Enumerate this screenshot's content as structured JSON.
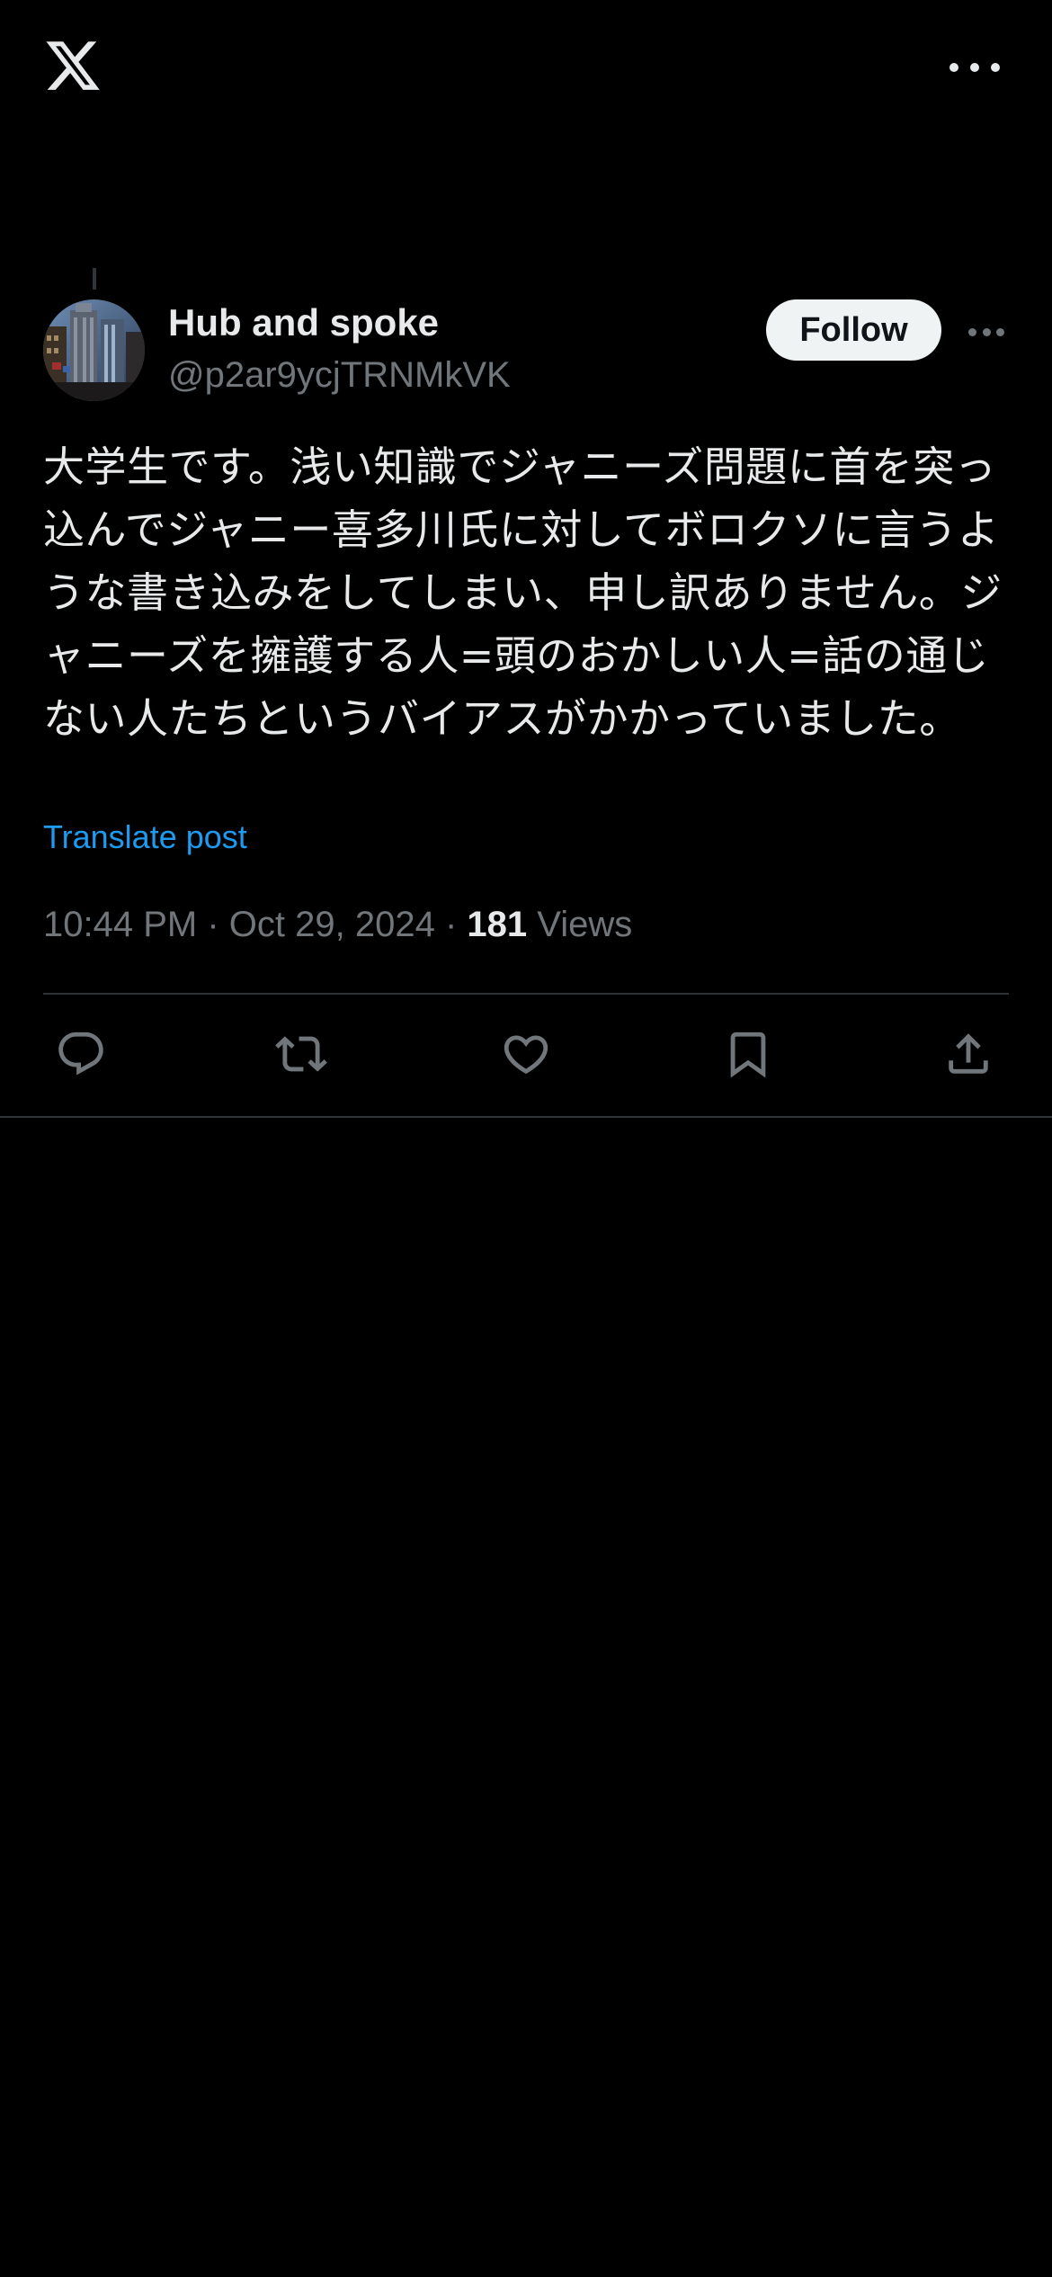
{
  "app": {
    "logo_icon": "x-logo-icon",
    "more_icon": "more-horizontal-icon"
  },
  "post": {
    "author": {
      "display_name": "Hub and spoke",
      "handle": "@p2ar9ycjTRNMkVK",
      "avatar_icon": "avatar-image"
    },
    "follow_label": "Follow",
    "text": "大学生です。浅い知識でジャニーズ問題に首を突っ込んでジャニー喜多川氏に対してボロクソに言うような書き込みをしてしまい、申し訳ありません。ジャニーズを擁護する人=頭のおかしい人=話の通じない人たちというバイアスがかかっていました。",
    "translate_label": "Translate post",
    "time": "10:44 PM",
    "separator": "·",
    "date": "Oct 29, 2024",
    "views_count": "181",
    "views_label": "Views"
  },
  "actions": [
    {
      "name": "reply",
      "icon": "reply-icon"
    },
    {
      "name": "repost",
      "icon": "repost-icon"
    },
    {
      "name": "like",
      "icon": "heart-icon"
    },
    {
      "name": "bookmark",
      "icon": "bookmark-icon"
    },
    {
      "name": "share",
      "icon": "share-icon"
    }
  ],
  "colors": {
    "background": "#000000",
    "text_primary": "#e7e9ea",
    "text_secondary": "#71767b",
    "link": "#1d9bf0",
    "follow_bg": "#eff3f4",
    "divider": "#2f3336"
  }
}
